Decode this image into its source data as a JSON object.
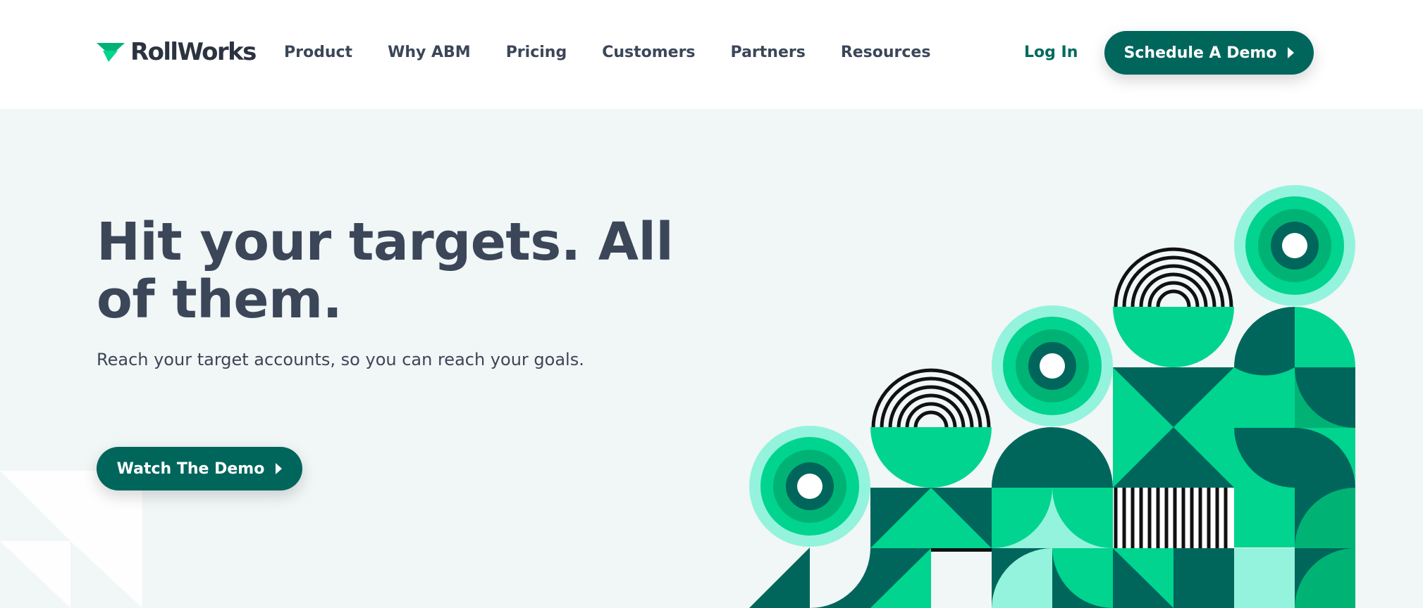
{
  "header": {
    "logo": {
      "text": "RollWorks",
      "icon": "rollworks-logo-icon"
    },
    "nav": [
      "Product",
      "Why ABM",
      "Pricing",
      "Customers",
      "Partners",
      "Resources"
    ],
    "login_label": "Log In",
    "cta_label": "Schedule A Demo",
    "cta_icon": "caret-right-icon"
  },
  "hero": {
    "title": "Hit your targets. All of them.",
    "subtitle": "Reach your target accounts, so you can reach your goals.",
    "cta_label": "Watch The Demo",
    "cta_icon": "caret-right-icon"
  },
  "colors": {
    "brand": "#00665c",
    "brand_dark": "#006a5e",
    "green_bright": "#00d48f",
    "green_mid": "#00b374",
    "mint": "#94f3dc",
    "text": "#3b4658",
    "hero_bg": "#f1f6f6"
  }
}
